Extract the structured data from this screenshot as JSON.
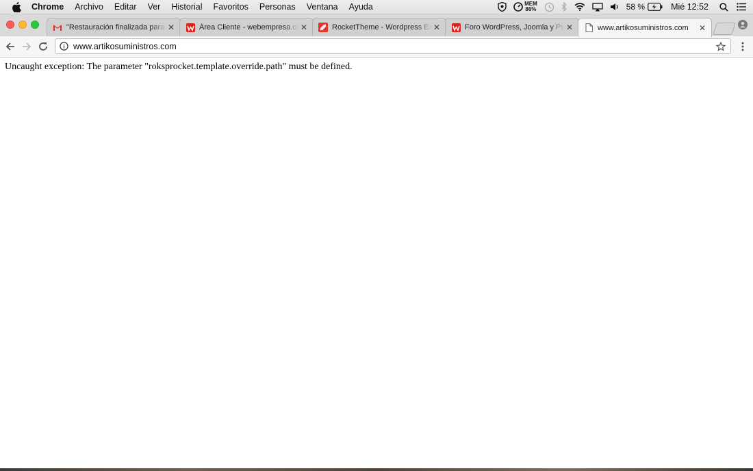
{
  "menubar": {
    "app_name": "Chrome",
    "items": [
      "Archivo",
      "Editar",
      "Ver",
      "Historial",
      "Favoritos",
      "Personas",
      "Ventana",
      "Ayuda"
    ],
    "status": {
      "mem_label": "MEM",
      "mem_value": "86%",
      "battery": "58 %",
      "clock": "Mié 12:52"
    }
  },
  "tabs": [
    {
      "title": "\"Restauración finalizada para",
      "icon": "gmail-icon",
      "active": false
    },
    {
      "title": "Área Cliente - webempresa.co",
      "icon": "webempresa-icon",
      "active": false
    },
    {
      "title": "RocketTheme - Wordpress Ext",
      "icon": "rockettheme-icon",
      "active": false
    },
    {
      "title": "Foro WordPress, Joomla y Pre",
      "icon": "webempresa-icon",
      "active": false
    },
    {
      "title": "www.artikosuministros.com",
      "icon": "page-icon",
      "active": true
    }
  ],
  "toolbar": {
    "url": "www.artikosuministros.com"
  },
  "page": {
    "error_message": "Uncaught exception: The parameter \"roksprocket.template.override.path\" must be defined."
  },
  "colors": {
    "close": "#fc5f57",
    "minimize": "#fdbc2f",
    "maximize": "#28c940",
    "gmail_red": "#d93025",
    "webempresa_red": "#e0211b"
  }
}
